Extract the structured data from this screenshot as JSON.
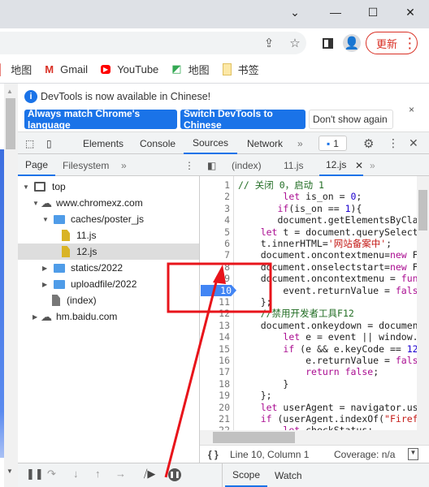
{
  "window": {
    "controls": [
      "⌄",
      "—",
      "☐",
      "✕"
    ]
  },
  "toolbar": {
    "update_label": "更新"
  },
  "bookmarks": [
    {
      "icon": "map-icon",
      "label": "地图"
    },
    {
      "icon": "gmail-icon",
      "label": "Gmail"
    },
    {
      "icon": "youtube-icon",
      "label": "YouTube"
    },
    {
      "icon": "google-maps-icon",
      "label": "地图"
    },
    {
      "icon": "folder-icon",
      "label": "书签"
    }
  ],
  "infobar": {
    "message": "DevTools is now available in Chinese!",
    "btn_match": "Always match Chrome's language",
    "btn_switch": "Switch DevTools to Chinese",
    "btn_dismiss": "Don't show again"
  },
  "devtools": {
    "tabs": [
      "Elements",
      "Console",
      "Sources",
      "Network"
    ],
    "active_tab": "Sources",
    "issues_count": "1"
  },
  "navigator": {
    "tabs": [
      "Page",
      "Filesystem"
    ],
    "tree": [
      "top",
      "www.chromexz.com",
      "caches/poster_js",
      "11.js",
      "12.js",
      "statics/2022",
      "uploadfile/2022",
      "(index)",
      "hm.baidu.com"
    ],
    "selected": "12.js"
  },
  "editor": {
    "tabs": [
      "(index)",
      "11.js",
      "12.js"
    ],
    "active_tab": "12.js",
    "highlighted_line": 10,
    "lines": [
      [
        [
          "c",
          "// 关闭 0，启动 1"
        ]
      ],
      [
        [
          "p",
          "        "
        ],
        [
          "k",
          "let"
        ],
        [
          "p",
          " is_on = "
        ],
        [
          "n",
          "0"
        ],
        [
          "p",
          ";"
        ]
      ],
      [
        [
          "p",
          "       "
        ],
        [
          "k",
          "if"
        ],
        [
          "p",
          "(is_on == "
        ],
        [
          "n",
          "1"
        ],
        [
          "p",
          "){"
        ]
      ],
      [
        [
          "p",
          "       document.getElementsByClassName"
        ]
      ],
      [
        [
          "p",
          "    "
        ],
        [
          "k",
          "let"
        ],
        [
          "p",
          " t = document.querySelector"
        ]
      ],
      [
        [
          "p",
          "    t.innerHTML="
        ],
        [
          "s",
          "'网站备案中'"
        ],
        [
          "p",
          ";"
        ]
      ],
      [
        [
          "p",
          "    document.oncontextmenu="
        ],
        [
          "k",
          "new"
        ],
        [
          "p",
          " Function"
        ]
      ],
      [
        [
          "p",
          "    document.onselectstart="
        ],
        [
          "k",
          "new"
        ],
        [
          "p",
          " Function"
        ]
      ],
      [
        [
          "p",
          "    document.oncontextmenu = "
        ],
        [
          "k",
          "function"
        ]
      ],
      [
        [
          "p",
          "        event.returnValue = "
        ],
        [
          "k",
          "false"
        ]
      ],
      [
        [
          "p",
          "    };"
        ]
      ],
      [
        [
          "p",
          "    "
        ],
        [
          "c",
          "//禁用开发者工具F12"
        ]
      ],
      [
        [
          "p",
          "    document.onkeydown = document"
        ]
      ],
      [
        [
          "p",
          "        "
        ],
        [
          "k",
          "let"
        ],
        [
          "p",
          " e = event || window.event"
        ]
      ],
      [
        [
          "p",
          "        "
        ],
        [
          "k",
          "if"
        ],
        [
          "p",
          " (e && e.keyCode == "
        ],
        [
          "n",
          "123"
        ]
      ],
      [
        [
          "p",
          "            e.returnValue = "
        ],
        [
          "k",
          "false"
        ]
      ],
      [
        [
          "p",
          "            "
        ],
        [
          "k",
          "return"
        ],
        [
          "p",
          " "
        ],
        [
          "k",
          "false"
        ],
        [
          "p",
          ";"
        ]
      ],
      [
        [
          "p",
          "        }"
        ]
      ],
      [
        [
          "p",
          "    };"
        ]
      ],
      [
        [
          "p",
          "    "
        ],
        [
          "k",
          "let"
        ],
        [
          "p",
          " userAgent = navigator.userAgent"
        ]
      ],
      [
        [
          "p",
          "    "
        ],
        [
          "k",
          "if"
        ],
        [
          "p",
          " (userAgent.indexOf("
        ],
        [
          "s",
          "\"Firefox\""
        ]
      ],
      [
        [
          "p",
          "        "
        ],
        [
          "k",
          "let"
        ],
        [
          "p",
          " checkStatus;"
        ]
      ]
    ]
  },
  "status": {
    "position": "Line 10, Column 1",
    "coverage": "Coverage: n/a"
  },
  "debugger": {
    "tabs": [
      "Scope",
      "Watch"
    ],
    "active_tab": "Scope"
  },
  "colors": {
    "accent": "#1a73e8",
    "annotation": "#e8141b"
  }
}
